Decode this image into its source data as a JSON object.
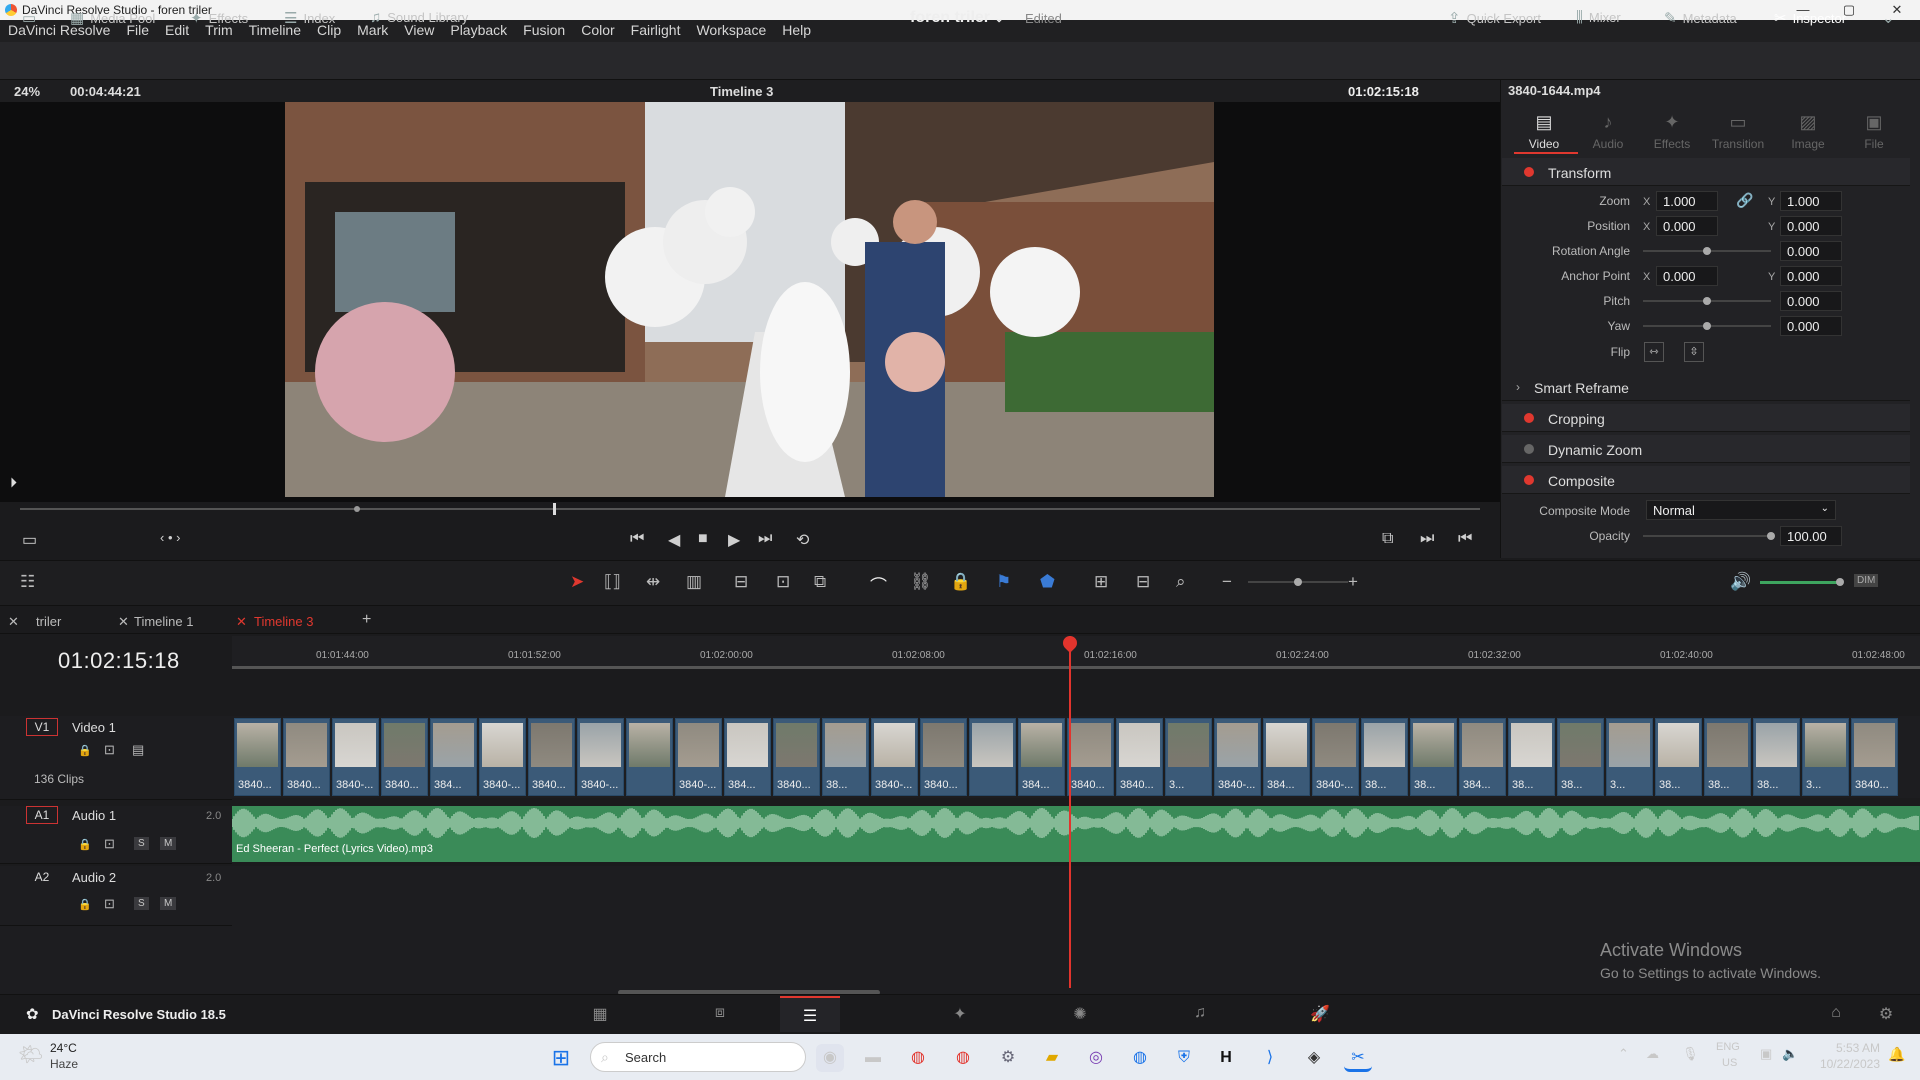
{
  "window": {
    "title": "DaVinci Resolve Studio - foren triler",
    "min": "—",
    "max": "▢",
    "close": "✕"
  },
  "menu": [
    "DaVinci Resolve",
    "File",
    "Edit",
    "Trim",
    "Timeline",
    "Clip",
    "Mark",
    "View",
    "Playback",
    "Fusion",
    "Color",
    "Fairlight",
    "Workspace",
    "Help"
  ],
  "toolbar": {
    "media_pool": "Media Pool",
    "effects": "Effects",
    "index": "Index",
    "sound_library": "Sound Library",
    "project": "foren triler",
    "edited": "Edited",
    "quick_export": "Quick Export",
    "mixer": "Mixer",
    "metadata": "Metadata",
    "inspector": "Inspector"
  },
  "viewer": {
    "zoom": "24%",
    "duration": "00:04:44:21",
    "timeline": "Timeline 3",
    "timecode": "01:02:15:18"
  },
  "inspector": {
    "clip": "3840-1644.mp4",
    "tabs": [
      "Video",
      "Audio",
      "Effects",
      "Transition",
      "Image",
      "File"
    ],
    "transform": "Transform",
    "zoom_label": "Zoom",
    "zoom_x": "1.000",
    "zoom_y": "1.000",
    "position_label": "Position",
    "pos_x": "0.000",
    "pos_y": "0.000",
    "rotation_label": "Rotation Angle",
    "rotation": "0.000",
    "anchor_label": "Anchor Point",
    "anchor_x": "0.000",
    "anchor_y": "0.000",
    "pitch_label": "Pitch",
    "pitch": "0.000",
    "yaw_label": "Yaw",
    "yaw": "0.000",
    "flip_label": "Flip",
    "smart_reframe": "Smart Reframe",
    "cropping": "Cropping",
    "dynamic_zoom": "Dynamic Zoom",
    "composite": "Composite",
    "composite_mode_label": "Composite Mode",
    "composite_mode": "Normal",
    "opacity_label": "Opacity",
    "opacity": "100.00",
    "x": "X",
    "y": "Y"
  },
  "timeline_tabs": [
    "triler",
    "Timeline 1",
    "Timeline 3"
  ],
  "timeline": {
    "timecode": "01:02:15:18",
    "ruler": [
      "01:01:44:00",
      "01:01:52:00",
      "01:02:00:00",
      "01:02:08:00",
      "01:02:16:00",
      "01:02:24:00",
      "01:02:32:00",
      "01:02:40:00",
      "01:02:48:00"
    ],
    "tracks": {
      "v1": {
        "id": "V1",
        "name": "Video 1",
        "clips": "136 Clips"
      },
      "a1": {
        "id": "A1",
        "name": "Audio 1",
        "ch": "2.0",
        "clip": "Ed Sheeran - Perfect (Lyrics Video).mp3"
      },
      "a2": {
        "id": "A2",
        "name": "Audio 2",
        "ch": "2.0"
      }
    },
    "clip_labels": [
      "3840...",
      "3840...",
      "3840-...",
      "3840...",
      "384...",
      "3840-...",
      "3840...",
      "3840-...",
      "",
      "3840-...",
      "384...",
      "3840...",
      "38...",
      "3840-...",
      "3840...",
      "",
      "384...",
      "3840...",
      "3840...",
      "3...",
      "3840-...",
      "384...",
      "3840-...",
      "38...",
      "38...",
      "384...",
      "38...",
      "38...",
      "3...",
      "38...",
      "38...",
      "38...",
      "3...",
      "3840..."
    ],
    "s": "S",
    "m": "M"
  },
  "statusbar": {
    "app": "DaVinci Resolve Studio 18.5"
  },
  "taskbar": {
    "temp": "24°C",
    "weather": "Haze",
    "search": "Search",
    "lang": "ENG",
    "region": "US",
    "time": "5:53 AM",
    "date": "10/22/2023"
  },
  "watermark": {
    "line1": "Activate Windows",
    "line2": "Go to Settings to activate Windows."
  }
}
